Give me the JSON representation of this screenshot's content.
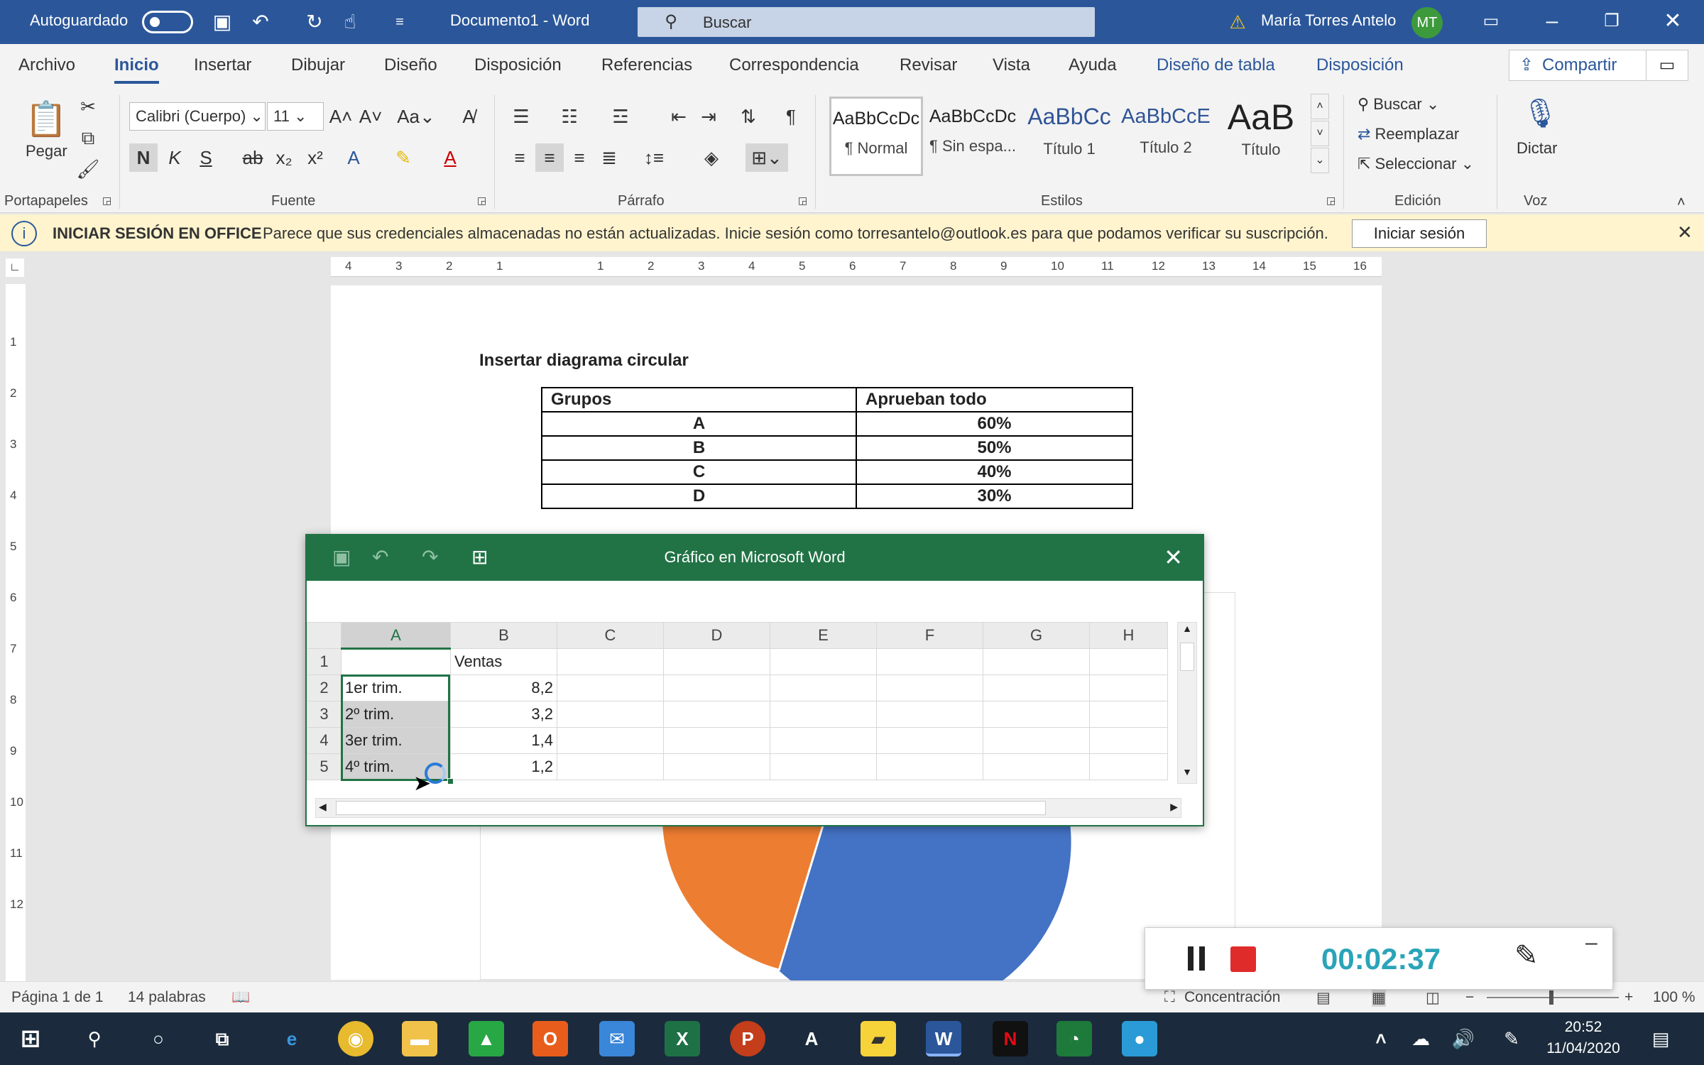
{
  "titlebar": {
    "autosave_label": "Autoguardado",
    "doc_title": "Documento1  -  Word",
    "search_placeholder": "Buscar",
    "user_name": "María Torres Antelo",
    "user_initials": "MT"
  },
  "menu": {
    "tabs": [
      "Archivo",
      "Inicio",
      "Insertar",
      "Dibujar",
      "Diseño",
      "Disposición",
      "Referencias",
      "Correspondencia",
      "Revisar",
      "Vista",
      "Ayuda",
      "Diseño de tabla",
      "Disposición"
    ],
    "active_tab": "Inicio",
    "share_label": "Compartir"
  },
  "ribbon": {
    "clipboard": {
      "paste_label": "Pegar",
      "group_label": "Portapapeles"
    },
    "font": {
      "font_name": "Calibri (Cuerpo)",
      "font_size": "11",
      "case_label": "Aa",
      "bold": "N",
      "italic": "K",
      "underline": "S",
      "strike": "ab",
      "sub": "x₂",
      "sup": "x²",
      "group_label": "Fuente"
    },
    "paragraph": {
      "group_label": "Párrafo"
    },
    "styles": {
      "items": [
        {
          "preview": "AaBbCcDc",
          "name": "¶ Normal"
        },
        {
          "preview": "AaBbCcDc",
          "name": "¶ Sin espa..."
        },
        {
          "preview": "AaBbCc",
          "name": "Título 1"
        },
        {
          "preview": "AaBbCcE",
          "name": "Título 2"
        },
        {
          "preview": "AaB",
          "name": "Título"
        }
      ],
      "group_label": "Estilos"
    },
    "editing": {
      "find": "Buscar",
      "replace": "Reemplazar",
      "select": "Seleccionar",
      "group_label": "Edición"
    },
    "voice": {
      "dictate": "Dictar",
      "group_label": "Voz"
    }
  },
  "notification": {
    "title": "INICIAR SESIÓN EN OFFICE",
    "message": "Parece que sus credenciales almacenadas no están actualizadas. Inicie sesión como torresantelo@outlook.es para que podamos verificar su suscripción.",
    "button": "Iniciar sesión"
  },
  "document": {
    "heading": "Insertar diagrama circular",
    "table": {
      "headers": [
        "Grupos",
        "Aprueban todo"
      ],
      "rows": [
        [
          "A",
          "60%"
        ],
        [
          "B",
          "50%"
        ],
        [
          "C",
          "40%"
        ],
        [
          "D",
          "30%"
        ]
      ]
    }
  },
  "excel": {
    "title": "Gráfico en Microsoft Word",
    "columns": [
      "A",
      "B",
      "C",
      "D",
      "E",
      "F",
      "G",
      "H"
    ],
    "rows": [
      {
        "n": "1",
        "a": "",
        "b": "Ventas"
      },
      {
        "n": "2",
        "a": "1er trim.",
        "b": "8,2"
      },
      {
        "n": "3",
        "a": "2º trim.",
        "b": "3,2"
      },
      {
        "n": "4",
        "a": "3er trim.",
        "b": "1,4"
      },
      {
        "n": "5",
        "a": "4º trim.",
        "b": "1,2"
      }
    ]
  },
  "statusbar": {
    "page": "Página 1 de 1",
    "words": "14 palabras",
    "focus": "Concentración",
    "zoom": "100 %"
  },
  "recorder": {
    "time": "00:02:37"
  },
  "taskbar": {
    "time": "20:52",
    "date": "11/04/2020"
  },
  "colors": {
    "word_blue": "#2b579a",
    "excel_green": "#217346",
    "pie_blue": "#4472c4",
    "pie_orange": "#ed7d31"
  }
}
